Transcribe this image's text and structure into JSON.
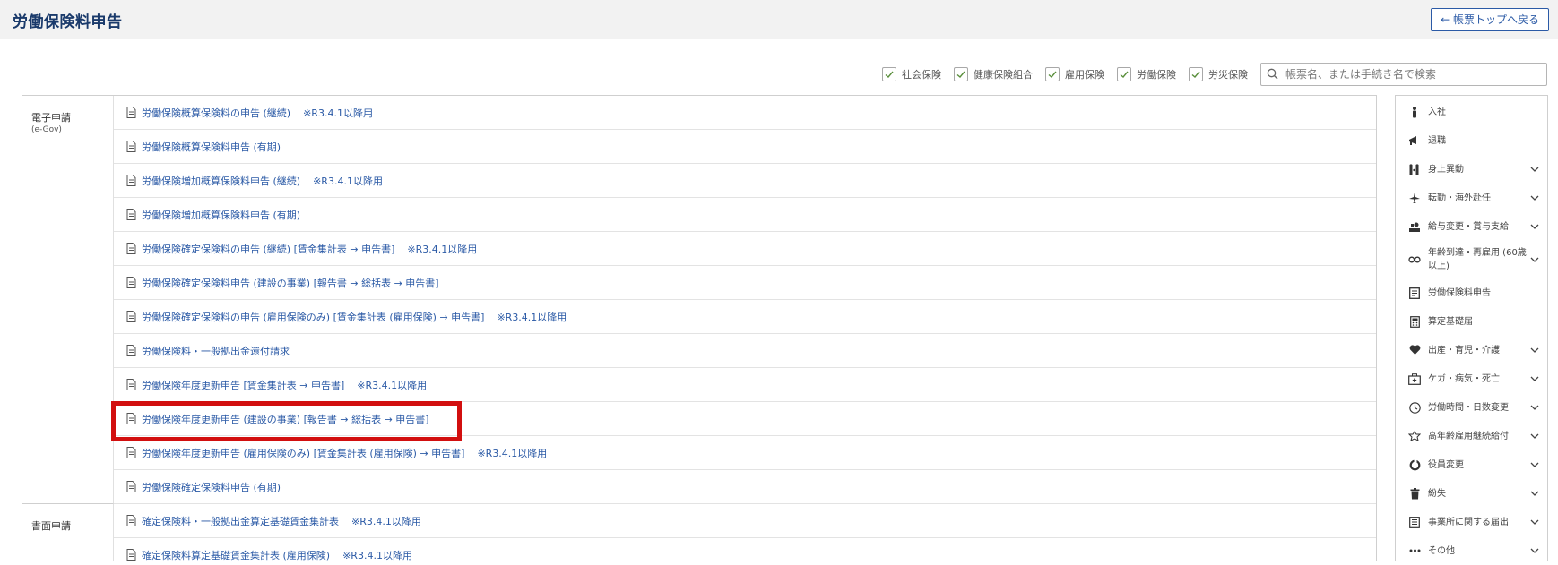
{
  "header": {
    "title": "労働保険料申告",
    "back_label": "← 帳票トップへ戻る"
  },
  "filters": [
    {
      "label": "社会保険",
      "checked": true
    },
    {
      "label": "健康保険組合",
      "checked": true
    },
    {
      "label": "雇用保険",
      "checked": true
    },
    {
      "label": "労働保険",
      "checked": true
    },
    {
      "label": "労災保険",
      "checked": true
    }
  ],
  "search": {
    "placeholder": "帳票名、または手続き名で検索",
    "value": ""
  },
  "sections": [
    {
      "label": "電子申請",
      "sub": "(e-Gov)",
      "items": [
        {
          "text": "労働保険概算保険料の申告 (継続)",
          "note": "※R3.4.1以降用"
        },
        {
          "text": "労働保険概算保険料申告 (有期)",
          "note": ""
        },
        {
          "text": "労働保険増加概算保険料申告 (継続)",
          "note": "※R3.4.1以降用"
        },
        {
          "text": "労働保険増加概算保険料申告 (有期)",
          "note": ""
        },
        {
          "text": "労働保険確定保険料の申告 (継続) [賃金集計表 → 申告書]",
          "note": "※R3.4.1以降用"
        },
        {
          "text": "労働保険確定保険料申告 (建設の事業) [報告書 → 総括表 → 申告書]",
          "note": ""
        },
        {
          "text": "労働保険確定保険料の申告 (雇用保険のみ) [賃金集計表 (雇用保険) → 申告書]",
          "note": "※R3.4.1以降用"
        },
        {
          "text": "労働保険料・一般拠出金還付請求",
          "note": ""
        },
        {
          "text": "労働保険年度更新申告 [賃金集計表 → 申告書]",
          "note": "※R3.4.1以降用"
        },
        {
          "text": "労働保険年度更新申告 (建設の事業) [報告書 → 総括表 → 申告書]",
          "note": ""
        },
        {
          "text": "労働保険年度更新申告 (雇用保険のみ) [賃金集計表 (雇用保険) → 申告書]",
          "note": "※R3.4.1以降用"
        },
        {
          "text": "労働保険確定保険料申告 (有期)",
          "note": ""
        }
      ]
    },
    {
      "label": "書面申請",
      "sub": "",
      "items": [
        {
          "text": "確定保険料・一般拠出金算定基礎賃金集計表",
          "note": "※R3.4.1以降用"
        },
        {
          "text": "確定保険料算定基礎賃金集計表 (雇用保険)",
          "note": "※R3.4.1以降用"
        }
      ]
    }
  ],
  "sidebar": [
    {
      "label": "入社",
      "icon": "person-icon",
      "expand": false
    },
    {
      "label": "退職",
      "icon": "megaphone-icon",
      "expand": false
    },
    {
      "label": "身上異動",
      "icon": "family-icon",
      "expand": true
    },
    {
      "label": "転勤・海外赴任",
      "icon": "airplane-icon",
      "expand": true
    },
    {
      "label": "給与変更・賞与支給",
      "icon": "money-hand-icon",
      "expand": true
    },
    {
      "label": "年齢到達・再雇用 (60歳以上)",
      "icon": "infinity-icon",
      "expand": true
    },
    {
      "label": "労働保険料申告",
      "icon": "document-icon",
      "expand": false
    },
    {
      "label": "算定基礎届",
      "icon": "calculator-icon",
      "expand": false
    },
    {
      "label": "出産・育児・介護",
      "icon": "heart-icon",
      "expand": true
    },
    {
      "label": "ケガ・病気・死亡",
      "icon": "first-aid-icon",
      "expand": true
    },
    {
      "label": "労働時間・日数変更",
      "icon": "clock-icon",
      "expand": true
    },
    {
      "label": "高年齢雇用継続給付",
      "icon": "elder-icon",
      "expand": true
    },
    {
      "label": "役員変更",
      "icon": "cycle-icon",
      "expand": true
    },
    {
      "label": "紛失",
      "icon": "trash-icon",
      "expand": true
    },
    {
      "label": "事業所に関する届出",
      "icon": "building-icon",
      "expand": true
    },
    {
      "label": "その他",
      "icon": "more-icon",
      "expand": true
    }
  ],
  "colors": {
    "title": "#1a3a6b",
    "link": "#2b5aa6",
    "highlight": "#d20f0f"
  }
}
